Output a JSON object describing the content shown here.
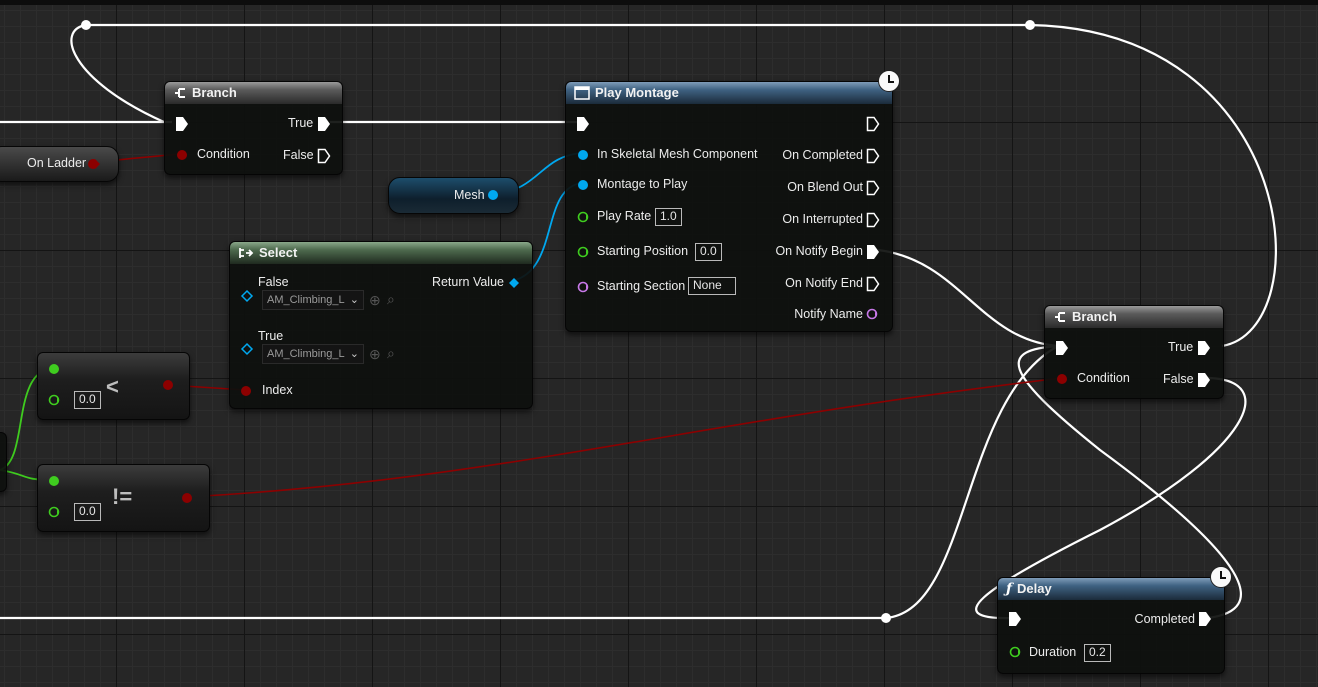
{
  "nodes": {
    "branch1": {
      "title": "Branch",
      "true_label": "True",
      "false_label": "False",
      "condition_label": "Condition"
    },
    "play_montage": {
      "title": "Play Montage",
      "inputs": {
        "skeletal_mesh": "In Skeletal Mesh Component",
        "montage": "Montage to Play",
        "play_rate": "Play Rate",
        "play_rate_value": "1.0",
        "starting_position": "Starting Position",
        "starting_position_value": "0.0",
        "starting_section": "Starting Section",
        "starting_section_value": "None"
      },
      "outputs": {
        "on_completed": "On Completed",
        "on_blend_out": "On Blend Out",
        "on_interrupted": "On Interrupted",
        "on_notify_begin": "On Notify Begin",
        "on_notify_end": "On Notify End",
        "notify_name": "Notify Name"
      }
    },
    "select": {
      "title": "Select",
      "false_label": "False",
      "false_value": "AM_Climbing_L",
      "true_label": "True",
      "true_value": "AM_Climbing_L",
      "index_label": "Index",
      "return_label": "Return Value"
    },
    "branch2": {
      "title": "Branch",
      "true_label": "True",
      "false_label": "False",
      "condition_label": "Condition"
    },
    "delay": {
      "title": "Delay",
      "completed_label": "Completed",
      "duration_label": "Duration",
      "duration_value": "0.2"
    },
    "less": {
      "operator": "<",
      "value": "0.0"
    },
    "not_equal": {
      "operator": "!=",
      "value": "0.0"
    },
    "on_ladder": {
      "label": "On Ladder"
    },
    "mesh": {
      "label": "Mesh"
    }
  },
  "icons": {
    "branch": "branch-icon",
    "function": "function-icon",
    "latent": "clock-icon",
    "select": "select-icon"
  },
  "colors": {
    "exec_wire": "#ffffff",
    "bool_pin": "#8c0000",
    "object_pin": "#00a8f0",
    "float_pin": "#3fcc1f",
    "name_pin": "#c778e8",
    "grid_bg": "#262626"
  }
}
